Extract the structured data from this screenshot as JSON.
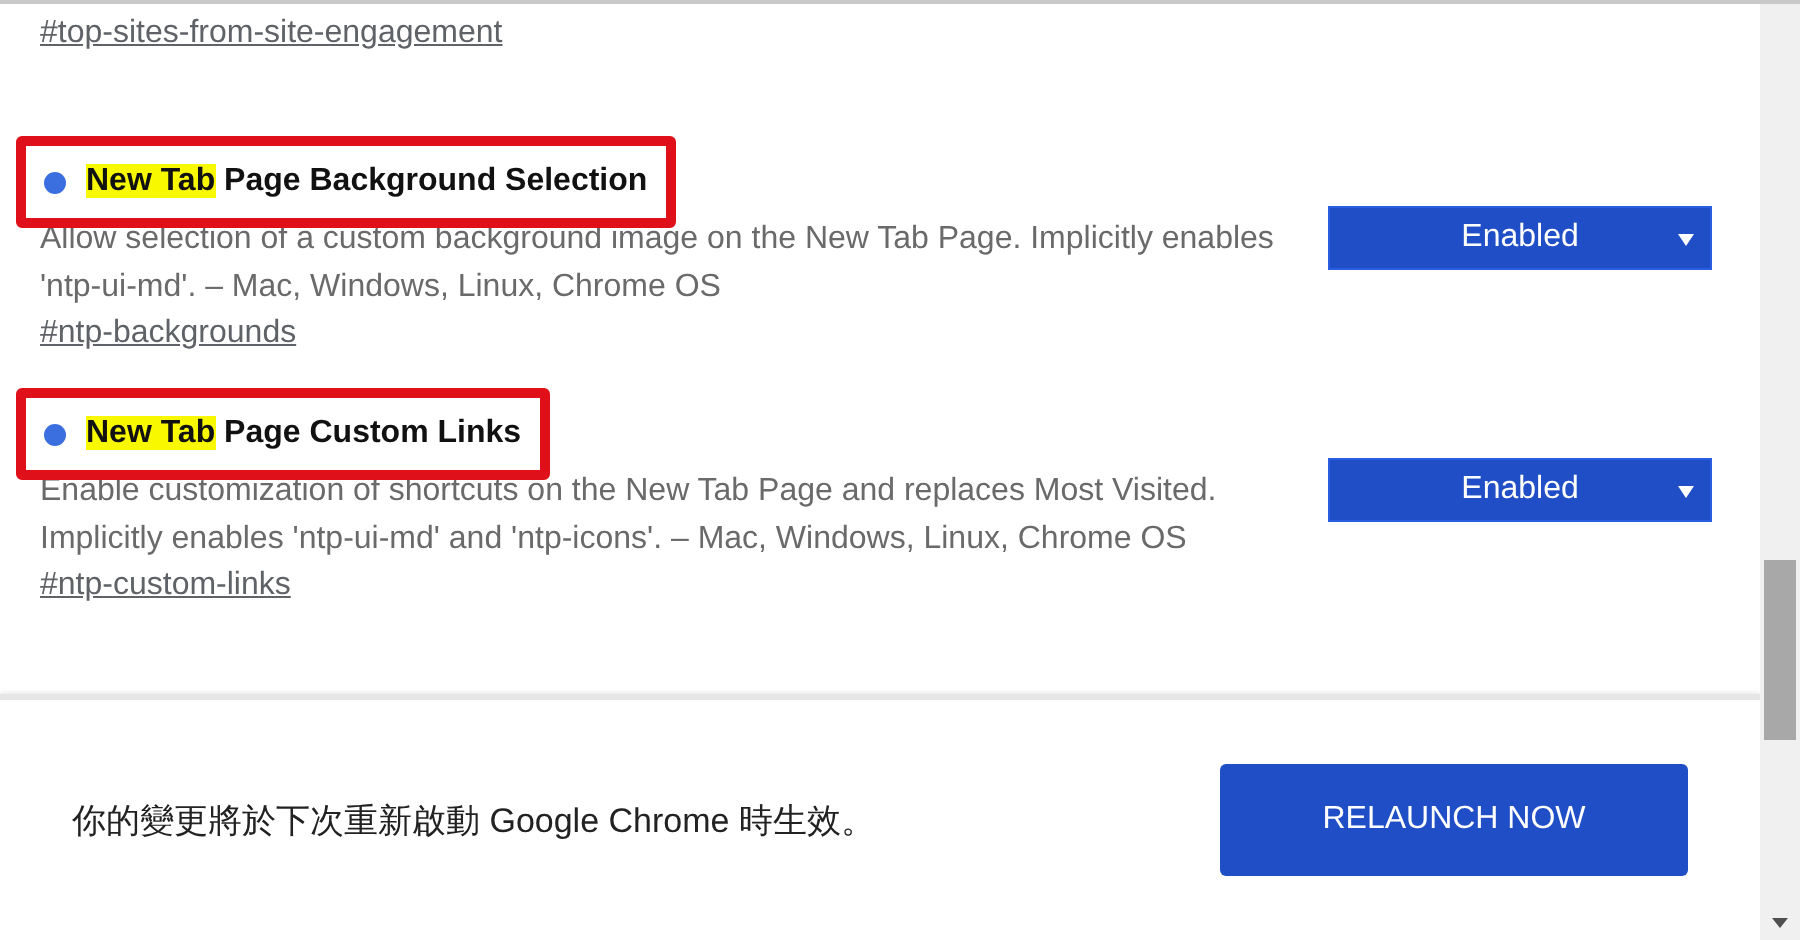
{
  "previous_flag": {
    "link": "#top-sites-from-site-engagement"
  },
  "flags": [
    {
      "modified": true,
      "annotated": true,
      "title": [
        {
          "text": "New Tab",
          "highlighted": true
        },
        {
          "text": " Page Background Selection",
          "highlighted": false
        }
      ],
      "description": "Allow selection of a custom background image on the New Tab Page. Implicitly enables 'ntp-ui-md'. – Mac, Windows, Linux, Chrome OS",
      "link": "#ntp-backgrounds",
      "value": "Enabled"
    },
    {
      "modified": true,
      "annotated": true,
      "title": [
        {
          "text": "New Tab",
          "highlighted": true
        },
        {
          "text": " Page Custom Links",
          "highlighted": false
        }
      ],
      "description": "Enable customization of shortcuts on the New Tab Page and replaces Most Visited. Implicitly enables 'ntp-ui-md' and 'ntp-icons'. – Mac, Windows, Linux, Chrome OS",
      "link": "#ntp-custom-links",
      "value": "Enabled"
    }
  ],
  "footer": {
    "message": "你的變更將於下次重新啟動 Google Chrome 時生效。",
    "button": "RELAUNCH NOW"
  }
}
